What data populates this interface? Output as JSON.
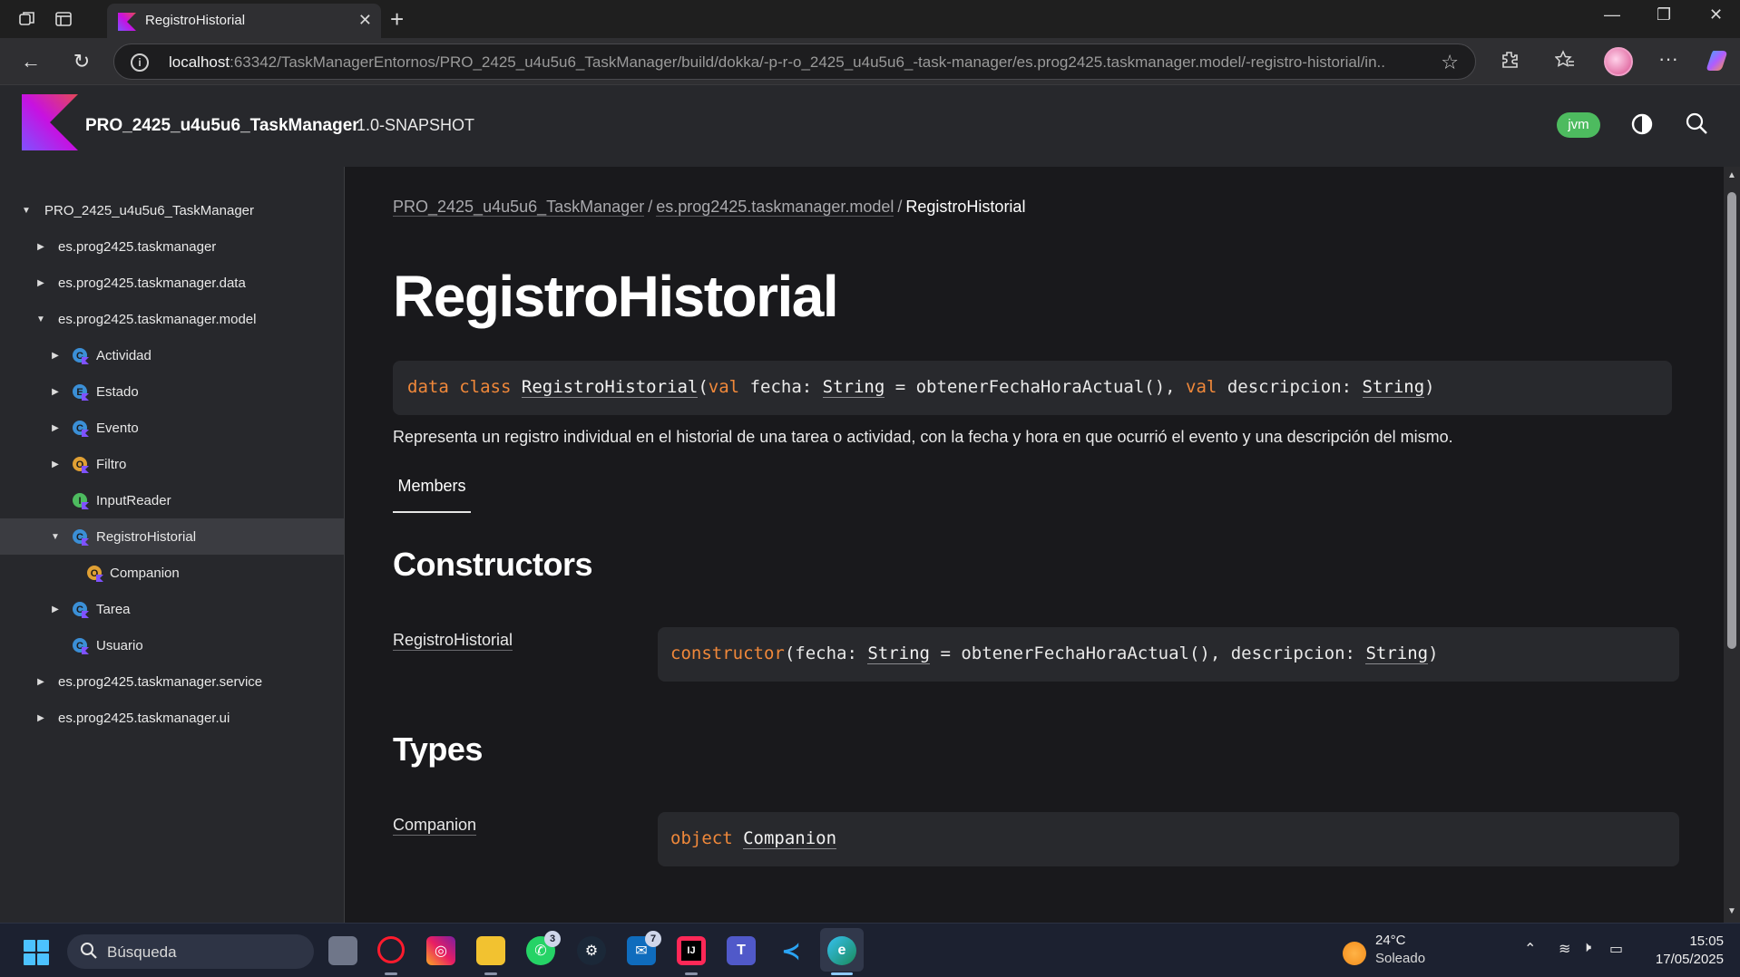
{
  "browser": {
    "tab_title": "RegistroHistorial",
    "url_host": "localhost",
    "url_rest": ":63342/TaskManagerEntornos/PRO_2425_u4u5u6_TaskManager/build/dokka/-p-r-o_2425_u4u5u6_-task-manager/es.prog2425.taskmanager.model/-registro-historial/in..."
  },
  "header": {
    "project_name": "PRO_2425_u4u5u6_TaskManager",
    "version": "1.0-SNAPSHOT",
    "platform_badge": "jvm"
  },
  "sidebar": {
    "items": [
      {
        "label": "PRO_2425_u4u5u6_TaskManager"
      },
      {
        "label": "es.prog2425.taskmanager"
      },
      {
        "label": "es.prog2425.taskmanager.data"
      },
      {
        "label": "es.prog2425.taskmanager.model"
      },
      {
        "label": "Actividad"
      },
      {
        "label": "Estado"
      },
      {
        "label": "Evento"
      },
      {
        "label": "Filtro"
      },
      {
        "label": "InputReader"
      },
      {
        "label": "RegistroHistorial"
      },
      {
        "label": "Companion"
      },
      {
        "label": "Tarea"
      },
      {
        "label": "Usuario"
      },
      {
        "label": "es.prog2425.taskmanager.service"
      },
      {
        "label": "es.prog2425.taskmanager.ui"
      }
    ]
  },
  "main": {
    "breadcrumb": [
      "PRO_2425_u4u5u6_TaskManager",
      "es.prog2425.taskmanager.model",
      "RegistroHistorial"
    ],
    "breadcrumb_sep": "/",
    "title": "RegistroHistorial",
    "signature": {
      "kw_data": "data",
      "kw_class": "class",
      "class_name": "RegistroHistorial",
      "open_paren": "(",
      "kw_val1": "val",
      "p1_name": "fecha: ",
      "type_string": "String",
      "default": " = obtenerFechaHoraActual(), ",
      "kw_val2": "val",
      "p2_name": "descripcion: ",
      "close_paren": ")"
    },
    "description": "Representa un registro individual en el historial de una tarea o actividad, con la fecha y hora en que ocurrió el evento y una descripción del mismo.",
    "members_tab": "Members",
    "constructors_heading": "Constructors",
    "constructor": {
      "link": "RegistroHistorial",
      "kw": "constructor",
      "open": "(fecha: ",
      "type": "String",
      "middle": " = obtenerFechaHoraActual(), descripcion: ",
      "close": ")"
    },
    "types_heading": "Types",
    "type_entry": {
      "link": "Companion",
      "kw": "object",
      "name": "Companion"
    }
  },
  "taskbar": {
    "search_placeholder": "Búsqueda",
    "whatsapp_badge": "3",
    "outlook_badge": "7",
    "weather_temp": "24°C",
    "weather_cond": "Soleado",
    "time": "15:05",
    "date": "17/05/2025"
  },
  "colors": {
    "keyword": "#f0883a",
    "badge_green": "#4dbb5f",
    "background": "#19191c",
    "panel": "#27282c"
  }
}
